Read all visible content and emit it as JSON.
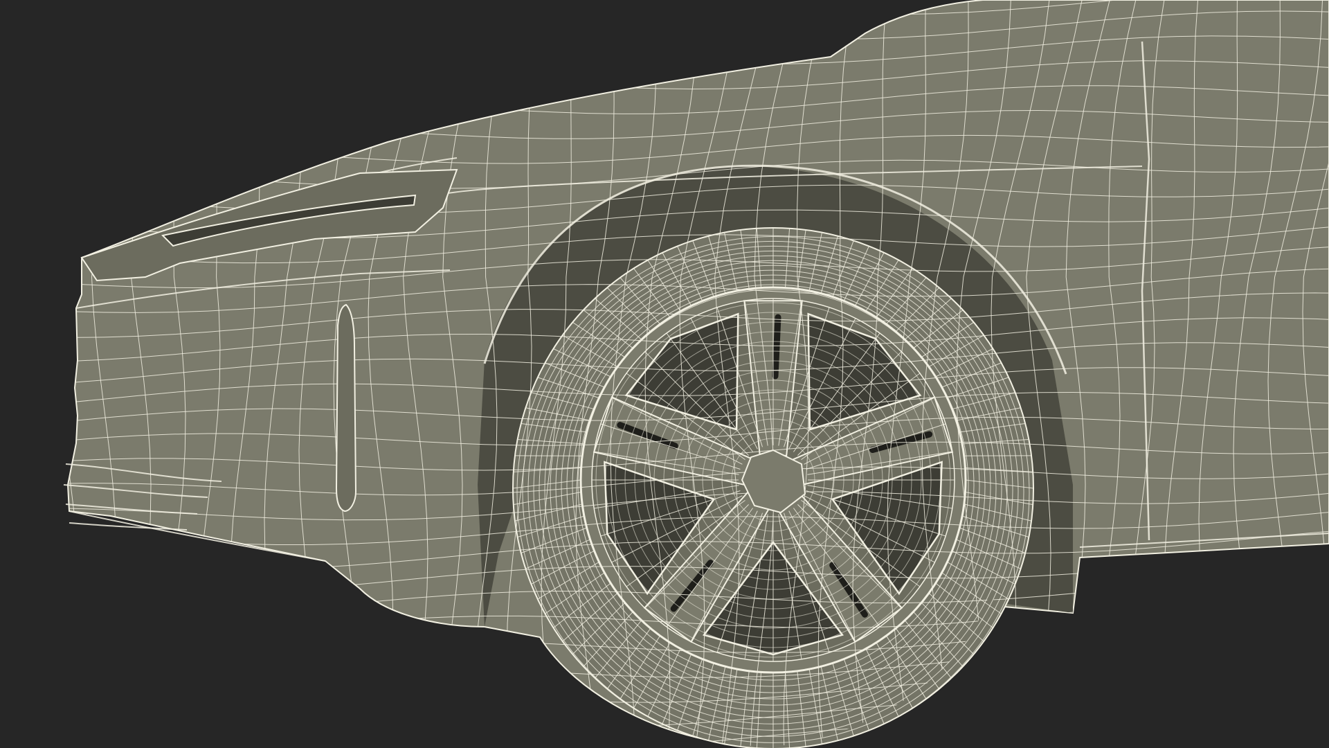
{
  "scene": {
    "subject": "car-front-quarter-wireframe",
    "colors": {
      "background": "#262626",
      "body_fill": "#7b7b6c",
      "body_fill_dark": "#6c6c5e",
      "shadow_fill": "#4c4c42",
      "cavity_fill": "#3d3d35",
      "wire_color": "#f2f0e2",
      "tire_fill": "#747466"
    },
    "wheel": {
      "spoke_count": 5
    }
  }
}
